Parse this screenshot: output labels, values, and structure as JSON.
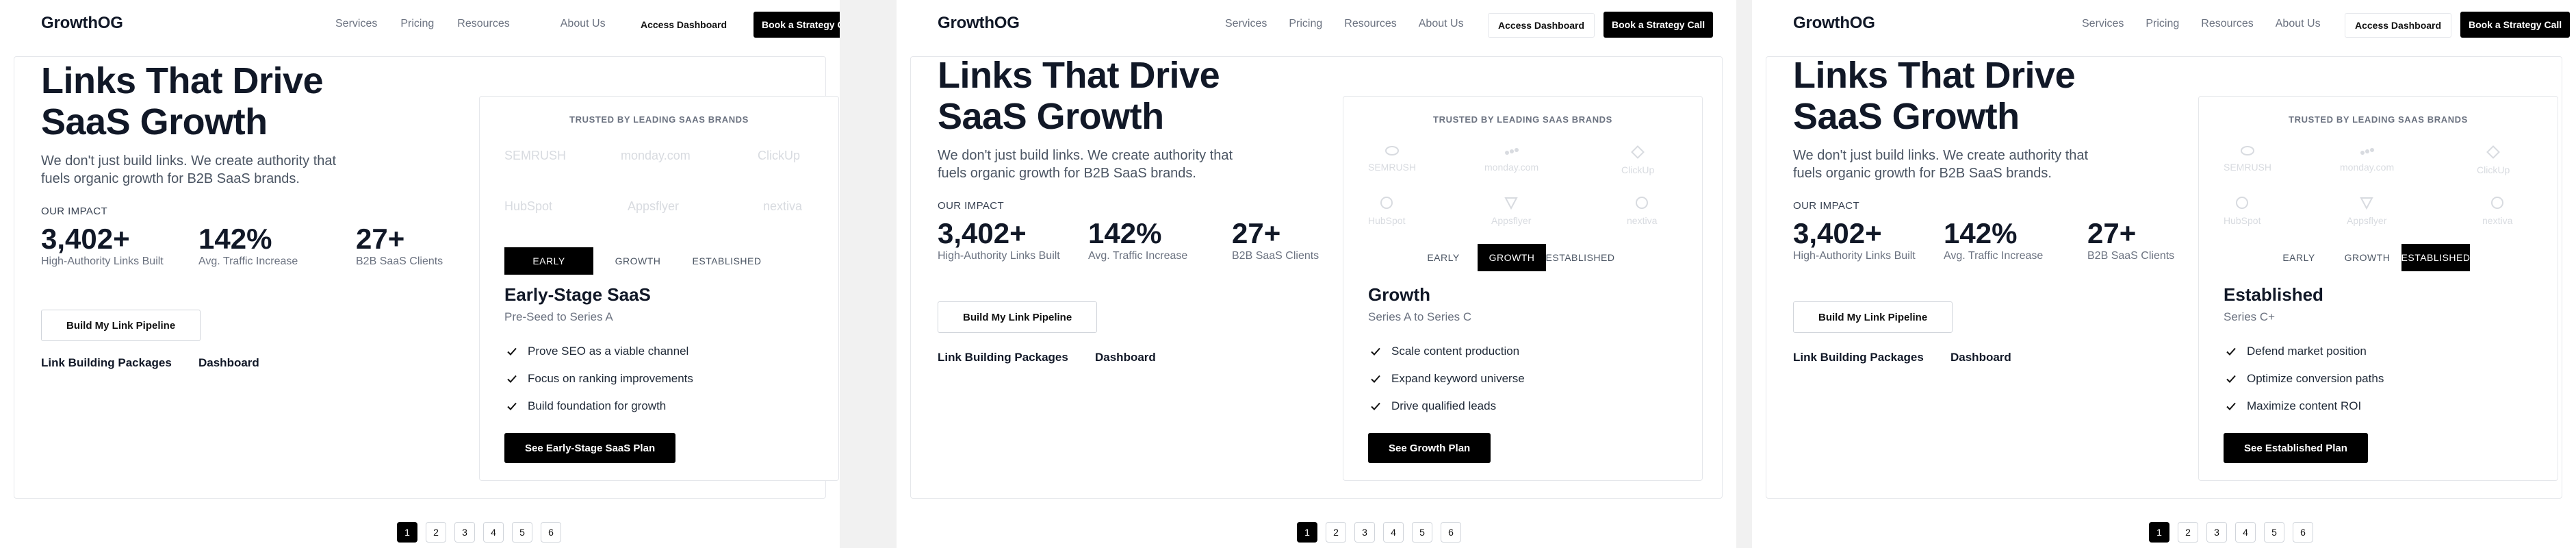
{
  "colors": {
    "accent": "#000000",
    "muted_text": "#6b7280",
    "border": "#e5e7eb",
    "logo_gray": "#d8dbe0"
  },
  "site": {
    "brand": "GrowthOG",
    "nav": [
      "Services",
      "Pricing",
      "Resources",
      "About Us"
    ],
    "access_dashboard": "Access Dashboard",
    "book_call": "Book a Strategy Call"
  },
  "hero": {
    "title_line1": "Links That Drive",
    "title_line2": "SaaS Growth",
    "subtitle": "We don't just build links. We create authority that fuels organic growth for B2B SaaS brands."
  },
  "impact": {
    "label": "OUR IMPACT",
    "stats": [
      {
        "value": "3,402+",
        "label": "High-Authority Links Built"
      },
      {
        "value": "142%",
        "label": "Avg. Traffic Increase"
      },
      {
        "value": "27+",
        "label": "B2B SaaS Clients"
      }
    ]
  },
  "cta": {
    "pipeline": "Build My Link Pipeline",
    "link_packages": "Link Building Packages",
    "dashboard": "Dashboard"
  },
  "trusted": {
    "heading": "TRUSTED BY LEADING SAAS BRANDS",
    "logos": [
      "SEMRUSH",
      "monday.com",
      "ClickUp",
      "HubSpot",
      "Appsflyer",
      "nextiva"
    ],
    "logo_icons": [
      "clock-logo-icon",
      "monday-logo-icon",
      "diamond-logo-icon",
      "circle-logo-icon",
      "triangle-logo-icon",
      "circle-logo-icon"
    ]
  },
  "tabs": [
    "EARLY",
    "GROWTH",
    "ESTABLISHED"
  ],
  "plans": [
    {
      "title": "Early-Stage SaaS",
      "subtitle": "Pre-Seed to Series A",
      "features": [
        "Prove SEO as a viable channel",
        "Focus on ranking improvements",
        "Build foundation for growth"
      ],
      "button": "See Early-Stage SaaS Plan"
    },
    {
      "title": "Growth",
      "subtitle": "Series A to Series C",
      "features": [
        "Scale content production",
        "Expand keyword universe",
        "Drive qualified leads"
      ],
      "button": "See Growth Plan"
    },
    {
      "title": "Established",
      "subtitle": "Series C+",
      "features": [
        "Defend market position",
        "Optimize conversion paths",
        "Maximize content ROI"
      ],
      "button": "See Established Plan"
    }
  ],
  "pagination": [
    "1",
    "2",
    "3",
    "4",
    "5",
    "6"
  ]
}
